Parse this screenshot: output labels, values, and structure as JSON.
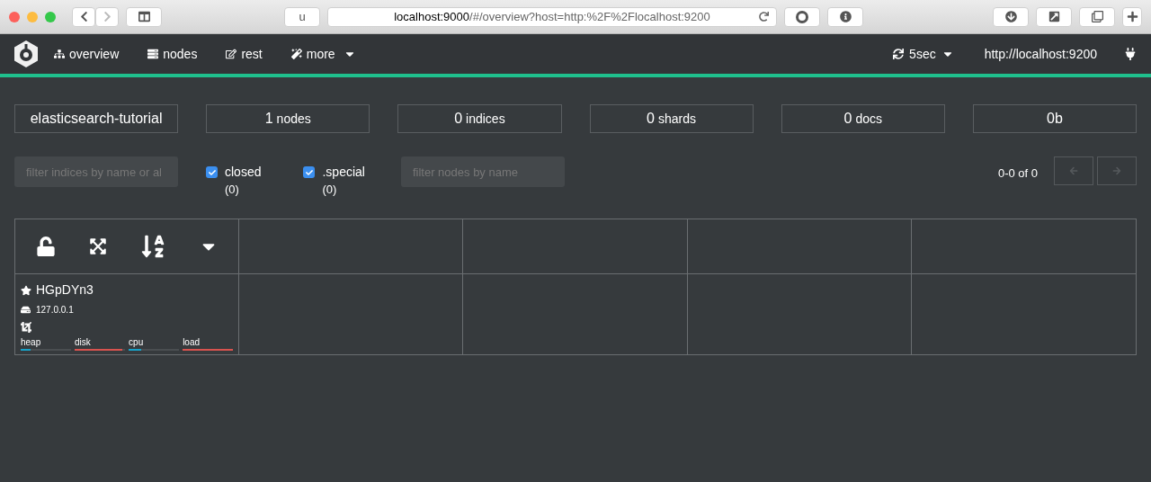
{
  "browser": {
    "reader_label": "u",
    "url_host": "localhost:9000",
    "url_path": "/#/overview?host=http:%2F%2Flocalhost:9200"
  },
  "navbar": {
    "items": [
      {
        "label": "overview",
        "dropdown": false
      },
      {
        "label": "nodes",
        "dropdown": false
      },
      {
        "label": "rest",
        "dropdown": false
      },
      {
        "label": "more",
        "dropdown": true
      }
    ],
    "refresh": "5sec",
    "host": "http://localhost:9200"
  },
  "stats": [
    {
      "value": "elasticsearch-tutorial"
    },
    {
      "value": "1",
      "unit": "nodes"
    },
    {
      "value": "0",
      "unit": "indices"
    },
    {
      "value": "0",
      "unit": "shards"
    },
    {
      "value": "0",
      "unit": "docs"
    },
    {
      "value": "0b"
    }
  ],
  "filters": {
    "indices_placeholder": "filter indices by name or al",
    "checkboxes": [
      {
        "label": "closed",
        "count": "(0)",
        "checked": true
      },
      {
        "label": ".special",
        "count": "(0)",
        "checked": true
      }
    ],
    "nodes_placeholder": "filter nodes by name",
    "pagination": "0-0 of 0"
  },
  "nodes": [
    {
      "name": "HGpDYn3",
      "master": true,
      "ip": "127.0.0.1",
      "metrics": [
        {
          "label": "heap",
          "level": 0.2,
          "color": "#17a2c8"
        },
        {
          "label": "disk",
          "level": 0.95,
          "color": "#d9534f"
        },
        {
          "label": "cpu",
          "level": 0.25,
          "color": "#17a2c8"
        },
        {
          "label": "load",
          "level": 1.0,
          "color": "#d9534f"
        }
      ]
    }
  ]
}
